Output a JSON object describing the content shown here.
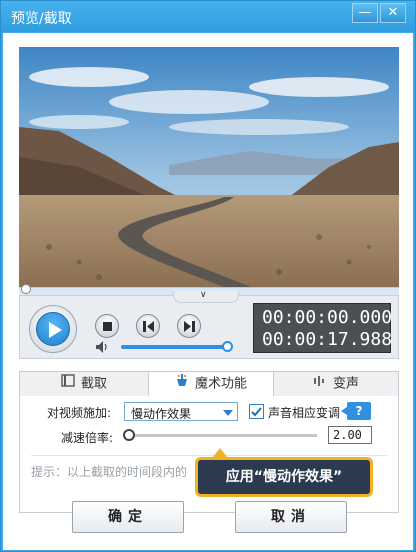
{
  "window": {
    "title": "预览/截取",
    "minimize_label": "—",
    "close_label": "✕"
  },
  "player": {
    "current_time": "00:00:00.000",
    "total_time": "00:00:17.988",
    "seek_progress": 0.0,
    "volume_level": 1.0
  },
  "tabs": [
    {
      "label": "截取",
      "icon": "film-icon"
    },
    {
      "label": "魔术功能",
      "icon": "magic-icon",
      "active": true
    },
    {
      "label": "变声",
      "icon": "waveform-icon"
    }
  ],
  "magic": {
    "effect_label": "对视频施加:",
    "effect_value": "慢动作效果",
    "pitch_label": "声音相应变调",
    "pitch_checked": true,
    "help_label": "?",
    "speed_label": "减速倍率:",
    "speed_value": "2.00",
    "hint": "提示：以上截取的时间段内的"
  },
  "callout": {
    "text": "应用“慢动作效果”"
  },
  "buttons": {
    "ok": "确定",
    "cancel": "取消"
  },
  "colors": {
    "accent": "#2f8fe0",
    "titlebar": "#3da9e8",
    "callout_border": "#f0b224",
    "callout_bg": "#2b3a4f"
  }
}
